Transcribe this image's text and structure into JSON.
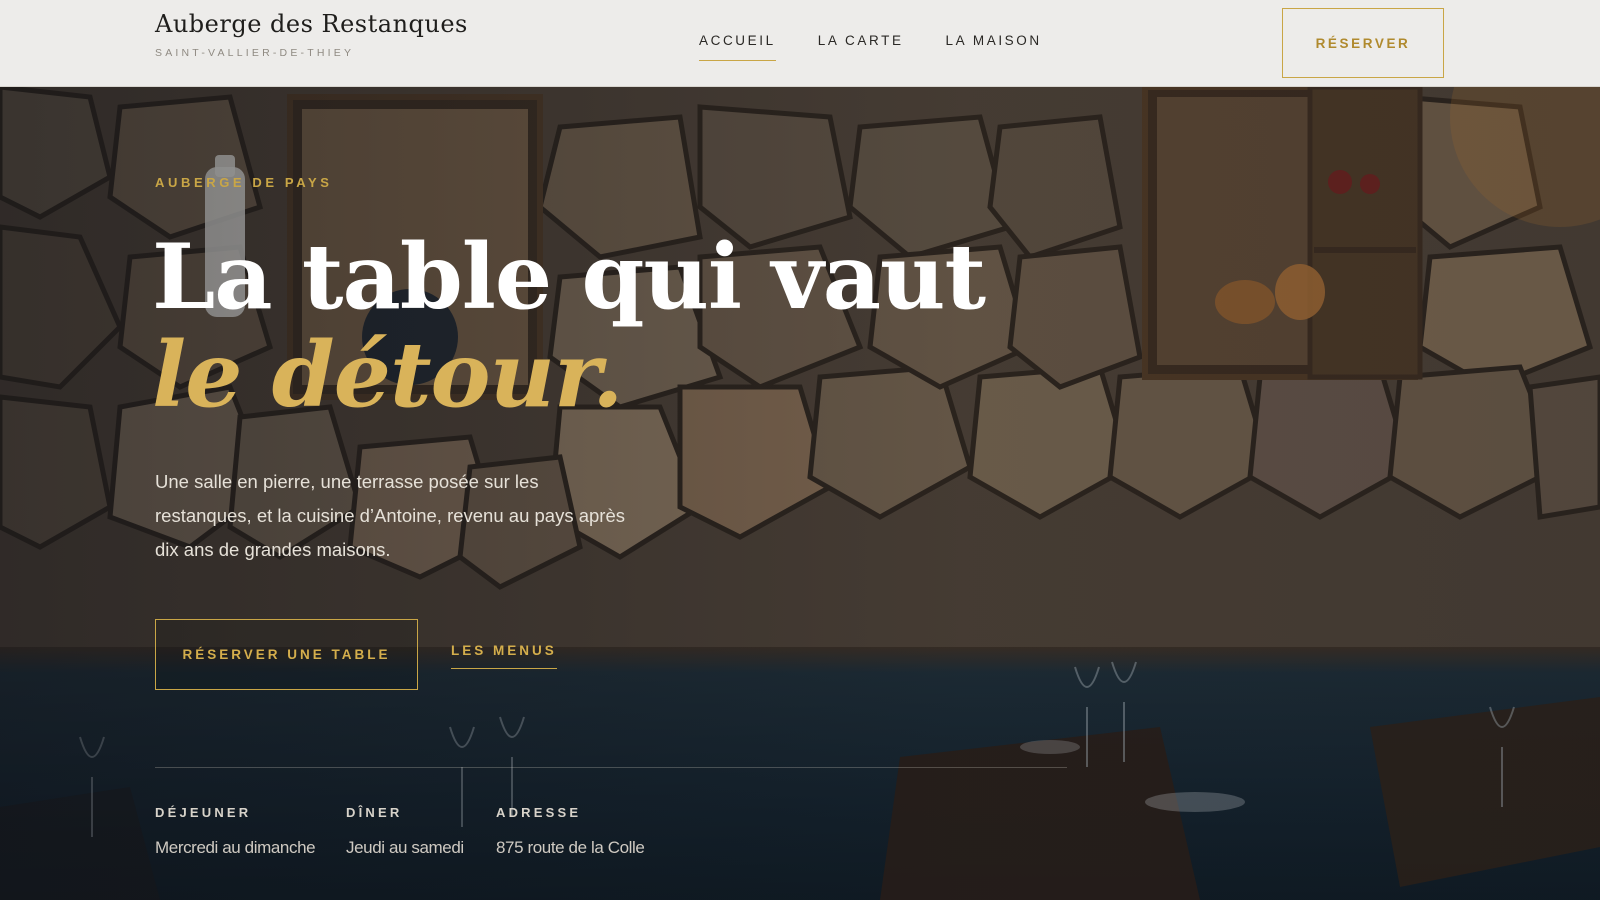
{
  "header": {
    "brand_name": "Auberge des Restanques",
    "brand_sub": "SAINT-VALLIER-DE-THIEY",
    "nav": [
      {
        "label": "ACCUEIL",
        "active": true
      },
      {
        "label": "LA CARTE",
        "active": false
      },
      {
        "label": "LA MAISON",
        "active": false
      }
    ],
    "reserve_label": "RÉSERVER"
  },
  "hero": {
    "eyebrow": "AUBERGE DE PAYS",
    "headline_line1": "La table qui vaut",
    "headline_line2": "le détour.",
    "lead": "Une salle en pierre, une terrasse posée sur les restanques, et la cuisine d’Antoine, revenu au pays après dix ans de grandes maisons.",
    "cta_primary": "RÉSERVER UNE TABLE",
    "cta_secondary": "LES MENUS"
  },
  "info": [
    {
      "title": "DÉJEUNER",
      "value": "Mercredi au dimanche"
    },
    {
      "title": "DÎNER",
      "value": "Jeudi au samedi"
    },
    {
      "title": "ADRESSE",
      "value": "875 route de la Colle"
    }
  ],
  "colors": {
    "accent": "#c9a646",
    "header_bg": "#edecea",
    "headline_italic": "#d9b35a"
  }
}
